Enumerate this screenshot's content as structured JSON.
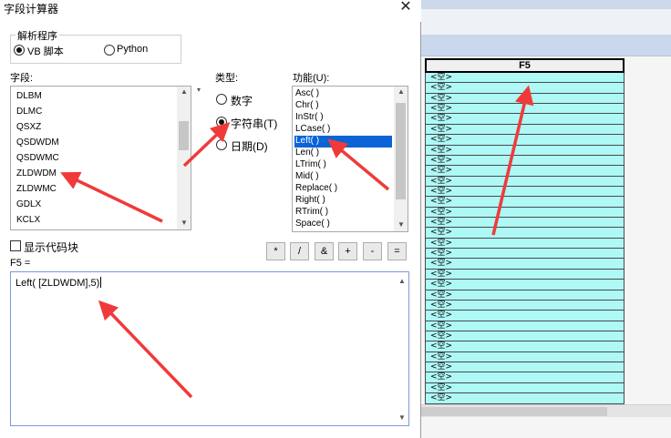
{
  "dialog": {
    "title": "字段计算器",
    "close_glyph": "✕"
  },
  "parser": {
    "group_label": "解析程序",
    "options": [
      "VB 脚本",
      "Python"
    ],
    "selected": "VB 脚本"
  },
  "fields": {
    "label": "字段:",
    "items": [
      "DLBM",
      "DLMC",
      "QSXZ",
      "QSDWDM",
      "QSDWMC",
      "ZLDWDM",
      "ZLDWMC",
      "GDLX",
      "KCLX"
    ]
  },
  "type": {
    "label": "类型:",
    "options": [
      "数字",
      "字符串(T)",
      "日期(D)"
    ],
    "selected": "字符串(T)"
  },
  "functions": {
    "label": "功能(U):",
    "items": [
      "Asc( )",
      "Chr( )",
      "InStr( )",
      "LCase( )",
      "Left( )",
      "Len( )",
      "LTrim( )",
      "Mid( )",
      "Replace( )",
      "Right( )",
      "RTrim( )",
      "Space( )"
    ],
    "selected": "Left( )"
  },
  "show_code_block": {
    "label": "显示代码块",
    "checked": false
  },
  "operators": [
    "*",
    "/",
    "&",
    "+",
    "-",
    "="
  ],
  "expression": {
    "label": "F5 =",
    "value": "Left( [ZLDWDM],5)"
  },
  "table": {
    "column_header": "F5",
    "cell_value": "<空>",
    "rows": [
      "<空>",
      "<空>",
      "<空>",
      "<空>",
      "<空>",
      "<空>",
      "<空>",
      "<空>",
      "<空>",
      "<空>",
      "<空>",
      "<空>",
      "<空>",
      "<空>",
      "<空>",
      "<空>",
      "<空>",
      "<空>",
      "<空>",
      "<空>",
      "<空>",
      "<空>",
      "<空>",
      "<空>",
      "<空>",
      "<空>",
      "<空>",
      "<空>",
      "<空>",
      "<空>",
      "<空>",
      "<空>"
    ]
  },
  "colors": {
    "cell_bg": "#aef8f6",
    "selection": "#0a64d6",
    "annotation_arrow": "#f03a3a"
  }
}
